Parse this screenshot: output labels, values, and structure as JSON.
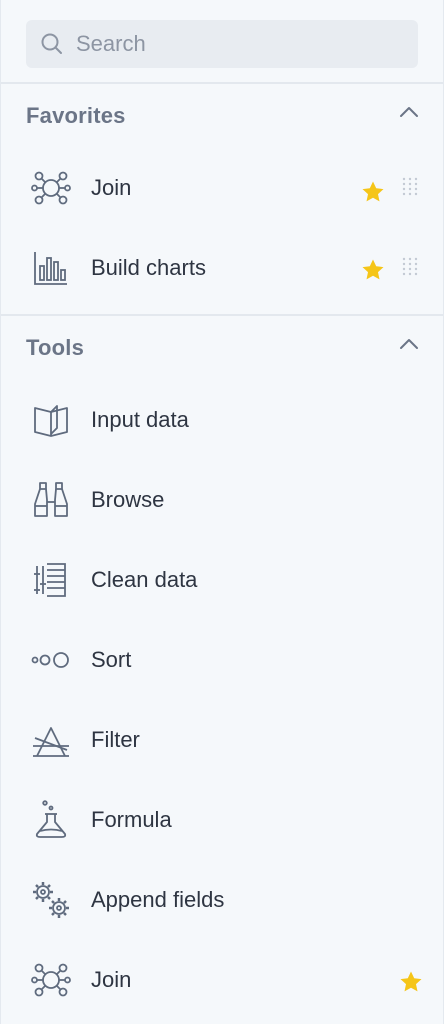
{
  "search": {
    "placeholder": "Search",
    "value": ""
  },
  "favorites": {
    "title": "Favorites",
    "items": [
      {
        "label": "Join",
        "icon": "join-icon",
        "starred": true
      },
      {
        "label": "Build charts",
        "icon": "bar-chart-icon",
        "starred": true
      }
    ]
  },
  "tools": {
    "title": "Tools",
    "items": [
      {
        "label": "Input data",
        "icon": "book-icon"
      },
      {
        "label": "Browse",
        "icon": "binoculars-icon"
      },
      {
        "label": "Clean data",
        "icon": "clean-data-icon"
      },
      {
        "label": "Sort",
        "icon": "sort-icon"
      },
      {
        "label": "Filter",
        "icon": "filter-icon"
      },
      {
        "label": "Formula",
        "icon": "flask-icon"
      },
      {
        "label": "Append fields",
        "icon": "gears-icon"
      },
      {
        "label": "Join",
        "icon": "join-icon",
        "starred": true
      }
    ]
  },
  "colors": {
    "background": "#f5f8fb",
    "icon_stroke": "#5f6b7e",
    "star": "#f5c518",
    "section_title": "#6b7587"
  }
}
